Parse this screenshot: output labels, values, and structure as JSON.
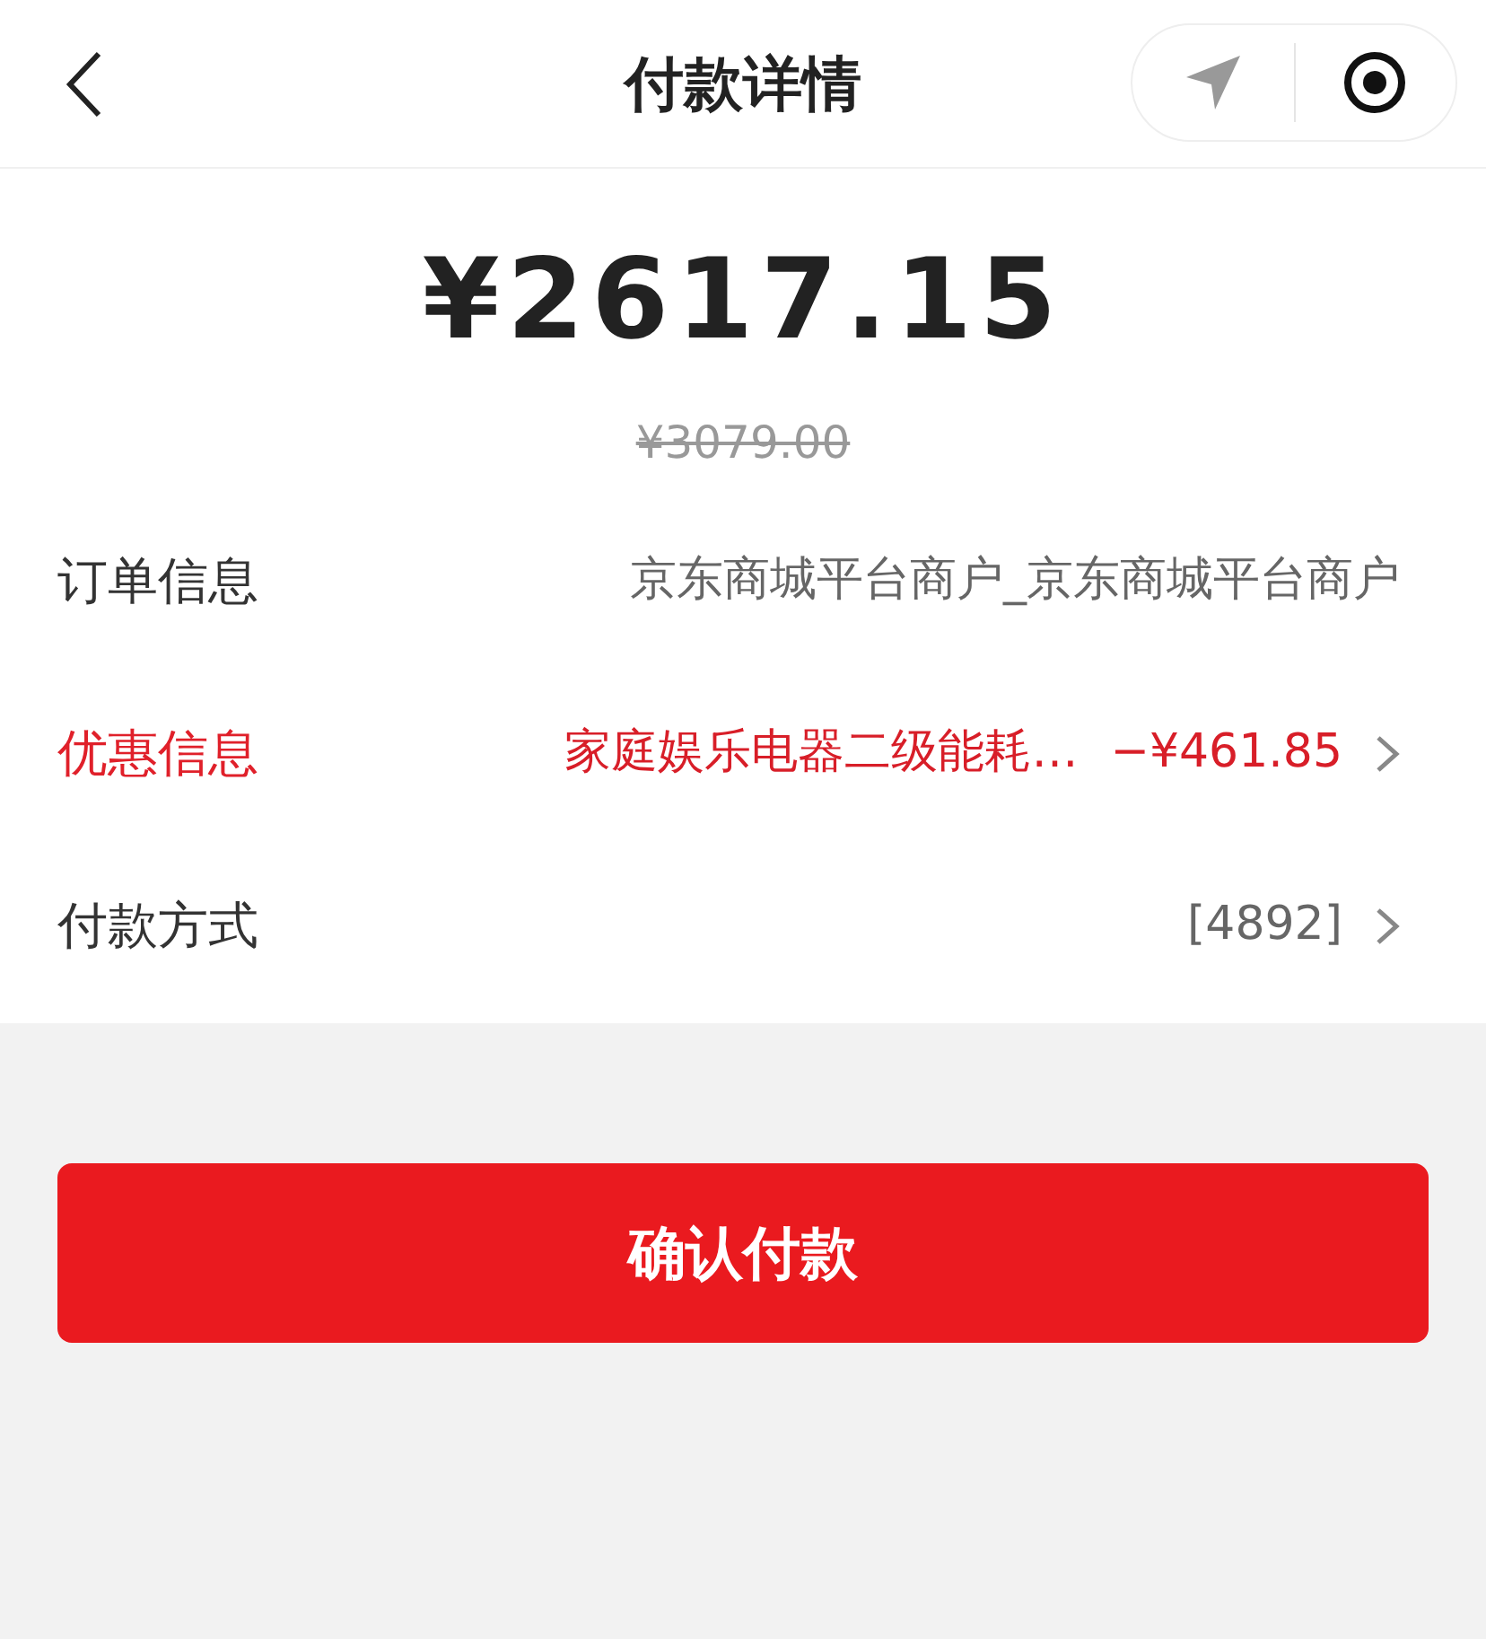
{
  "header": {
    "title": "付款详情"
  },
  "amount": {
    "total": "¥2617.15",
    "original": "¥3079.00"
  },
  "rows": [
    {
      "label": "订单信息",
      "value": "京东商城平台商户_京东商城平台商户",
      "kind": "plain",
      "highlight": false
    },
    {
      "label": "优惠信息",
      "value": "家庭娱乐电器二级能耗…",
      "extra": "−¥461.85",
      "kind": "link",
      "highlight": true
    },
    {
      "label": "付款方式",
      "value": "[4892]",
      "kind": "link",
      "highlight": false
    }
  ],
  "confirm_button": "确认付款"
}
